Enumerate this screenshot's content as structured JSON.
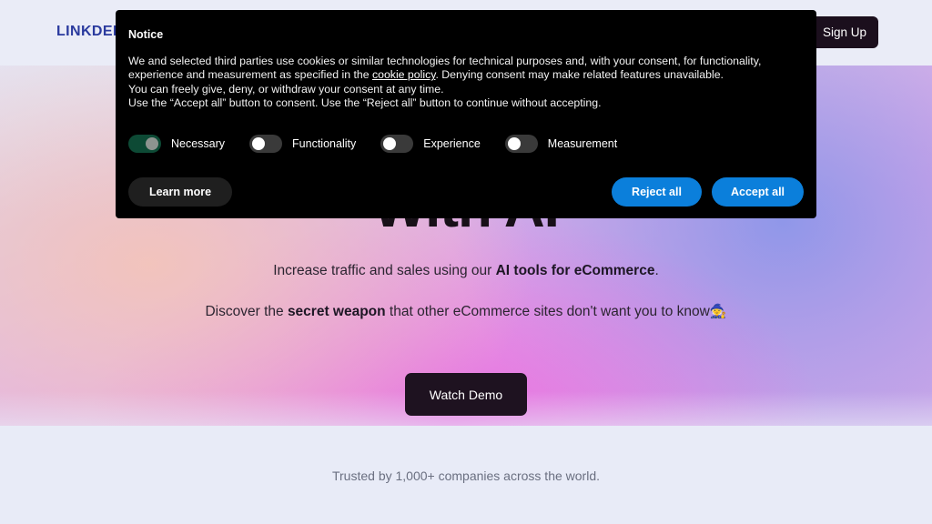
{
  "nav": {
    "logo_text": "LINKDELT",
    "signup_label": "Sign Up"
  },
  "hero": {
    "headline": "With AI",
    "sub_line_1_pre": "Increase traffic and sales using our ",
    "sub_line_1_bold": "AI tools for eCommerce",
    "sub_line_1_post": ".",
    "sub_line_2_pre": "Discover the ",
    "sub_line_2_bold": "secret weapon",
    "sub_line_2_post": " that other eCommerce sites don't want you to know",
    "sub_line_2_emoji": "🧙",
    "cta_label": "Watch Demo"
  },
  "footer": {
    "trusted_text": "Trusted by 1,000+ companies across the world."
  },
  "cookie_banner": {
    "title": "Notice",
    "paragraph_1_part_1": "We and selected third parties use cookies or similar technologies for technical purposes and, with your consent, for functionality, experience and measurement as specified in the ",
    "cookie_policy_link": "cookie policy",
    "paragraph_1_part_2": ". Denying consent may make related features unavailable.",
    "paragraph_2": "You can freely give, deny, or withdraw your consent at any time.",
    "paragraph_3": "Use the “Accept all” button to consent. Use the “Reject all” button to continue without accepting.",
    "toggles": [
      {
        "label": "Necessary",
        "state": "on"
      },
      {
        "label": "Functionality",
        "state": "off"
      },
      {
        "label": "Experience",
        "state": "off"
      },
      {
        "label": "Measurement",
        "state": "off"
      }
    ],
    "learn_more_label": "Learn more",
    "reject_all_label": "Reject all",
    "accept_all_label": "Accept all"
  },
  "colors": {
    "banner_bg": "#000000",
    "accent_blue": "#0b7fdb",
    "toggle_on_green": "#0d4a35",
    "toggle_off_gray": "#3a3a3a",
    "dark_button": "#1e1220",
    "logo_blue": "#2a3a9e",
    "page_bg": "#e8ebf7"
  }
}
